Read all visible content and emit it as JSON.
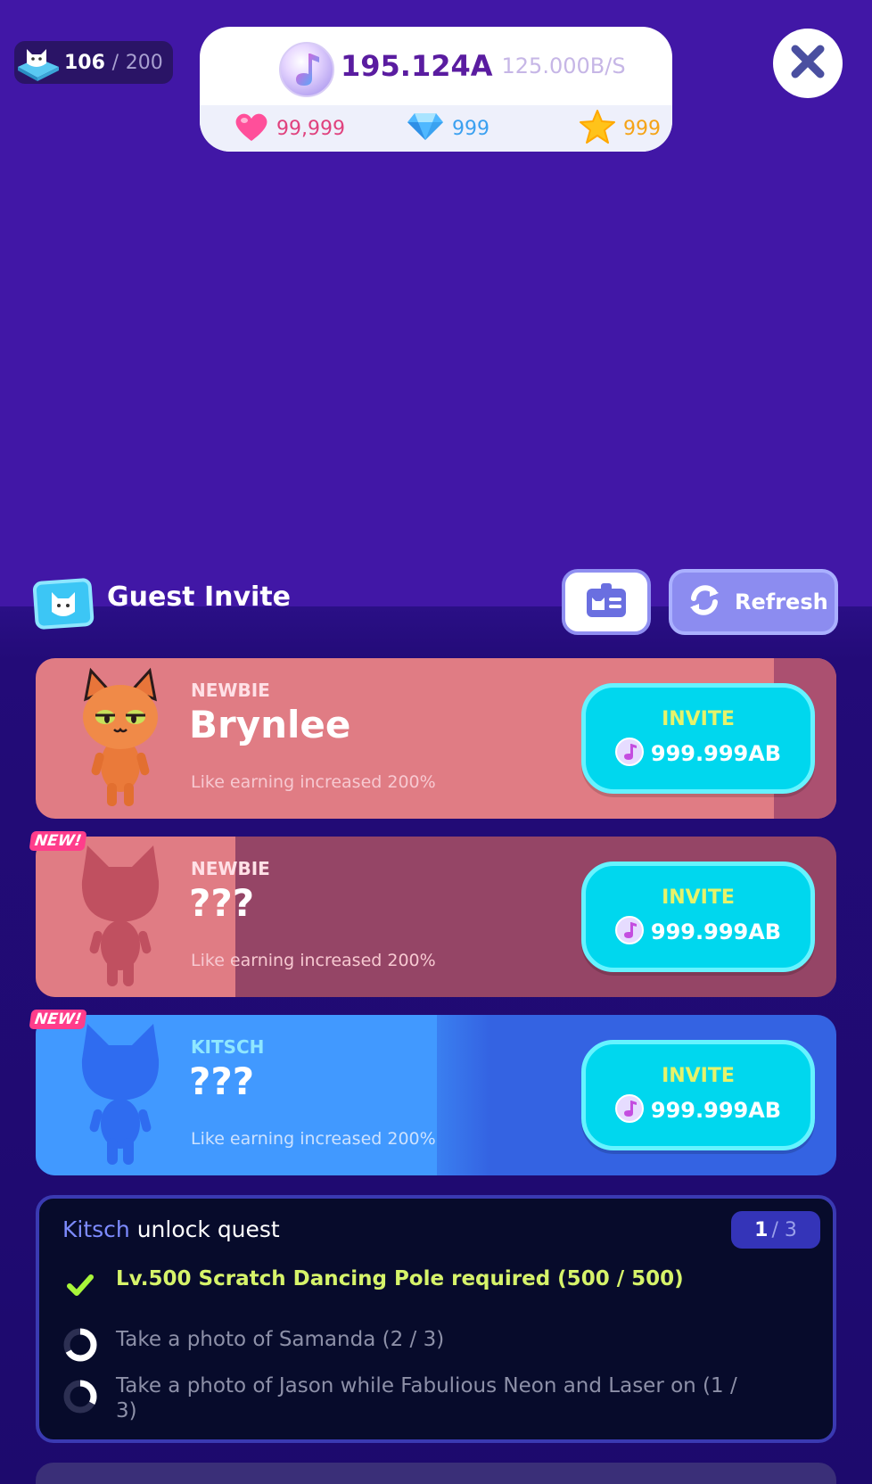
{
  "hud": {
    "capacity_current": "106",
    "capacity_separator": "/",
    "capacity_max": "200",
    "currency_main": "195.124A",
    "currency_rate": "125.000B/S",
    "hearts": "99,999",
    "gems": "999",
    "stars": "999"
  },
  "header": {
    "title": "Guest Invite",
    "refresh_label": "Refresh"
  },
  "guests": [
    {
      "rarity": "NEWBIE",
      "name": "Brynlee",
      "desc": "Like earning increased 200%",
      "invite_label": "INVITE",
      "cost": "999.999AB",
      "is_new": false
    },
    {
      "rarity": "NEWBIE",
      "name": "???",
      "desc": "Like earning increased 200%",
      "invite_label": "INVITE",
      "cost": "999.999AB",
      "is_new": true,
      "new_label": "NEW!"
    },
    {
      "rarity": "KITSCH",
      "name": "???",
      "desc": "Like earning increased 200%",
      "invite_label": "INVITE",
      "cost": "999.999AB",
      "is_new": true,
      "new_label": "NEW!"
    }
  ],
  "quest": {
    "title_highlight": "Kitsch",
    "title_rest": " unlock quest",
    "progress_current": "1",
    "progress_rest": "/ 3",
    "items": [
      {
        "text": "Lv.500 Scratch Dancing Pole required (500 / 500)",
        "done": true
      },
      {
        "text": "Take a photo of Samanda (2 / 3)",
        "done": false,
        "progress": 0.67
      },
      {
        "text": "Take a photo of Jason while Fabulious Neon and Laser on (1 / 3)",
        "done": false,
        "progress": 0.33
      }
    ]
  },
  "colors": {
    "background": "#4117a6",
    "invite_button": "#00d7ee",
    "invite_text": "#e6f36a",
    "newbie_card": "#e07c84",
    "kitsch_card": "#4199ff",
    "quest_done": "#d6f36a"
  },
  "icons": {
    "capacity": "cat-ticket-icon",
    "currency": "music-note-orb-icon",
    "hearts": "heart-icon",
    "gems": "gem-icon",
    "stars": "star-icon",
    "close": "close-icon",
    "guest_list": "id-card-icon",
    "refresh": "refresh-icon"
  }
}
